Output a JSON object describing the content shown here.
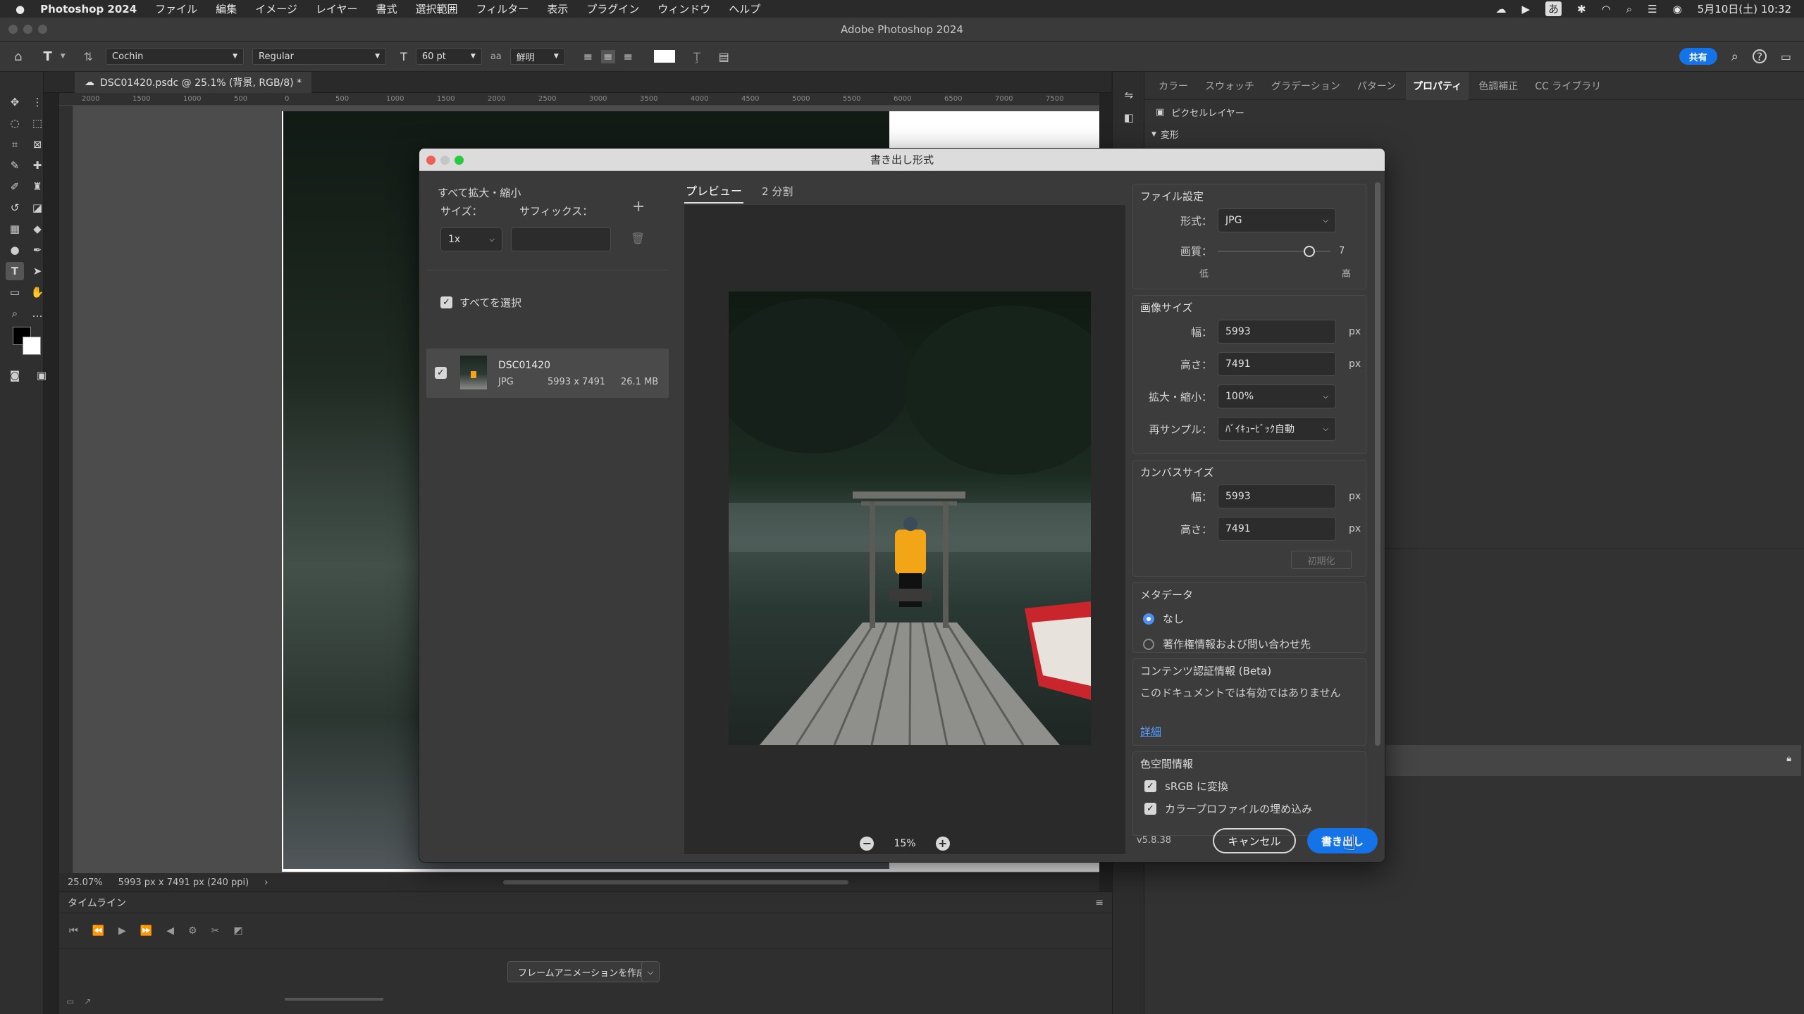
{
  "menubar": {
    "app_name": "Photoshop 2024",
    "items": [
      "ファイル",
      "編集",
      "イメージ",
      "レイヤー",
      "書式",
      "選択範囲",
      "フィルター",
      "表示",
      "プラグイン",
      "ウィンドウ",
      "ヘルプ"
    ],
    "ime": "あ",
    "datetime": "5月10日(土) 10:32"
  },
  "window": {
    "title": "Adobe Photoshop 2024"
  },
  "options": {
    "font_family": "Cochin",
    "font_style": "Regular",
    "font_size": "60 pt",
    "antialias_icon_label": "aa",
    "antialias": "鮮明",
    "share_label": "共有"
  },
  "document": {
    "tab_title": "DSC01420.psdc @ 25.1% (背景, RGB/8) *",
    "ruler_ticks": [
      "2000",
      "1500",
      "1000",
      "500",
      "0",
      "500",
      "1000",
      "1500",
      "2000",
      "2500",
      "3000",
      "3500",
      "4000",
      "4500",
      "5000",
      "5500",
      "6000",
      "6500",
      "7000",
      "7500"
    ],
    "zoom": "25.07%",
    "dims": "5993 px x 7491 px (240 ppi)"
  },
  "timeline": {
    "title": "タイムライン",
    "create_button": "フレームアニメーションを作成"
  },
  "right_panel": {
    "tabs": [
      "カラー",
      "スウォッチ",
      "グラデーション",
      "パターン",
      "プロパティ",
      "色調補正",
      "CC ライブラリ"
    ],
    "active_tab": "プロパティ",
    "layer_type": "ピクセルレイヤー",
    "section": "変形"
  },
  "dialog": {
    "title": "書き出し形式",
    "scale_section": "すべて拡大・縮小",
    "size_label": "サイズ：",
    "suffix_label": "サフィックス：",
    "scale_value": "1x",
    "select_all": "すべてを選択",
    "file": {
      "name": "DSC01420",
      "format": "JPG",
      "dims": "5993 x 7491",
      "size": "26.1 MB"
    },
    "preview_tabs": [
      "プレビュー",
      "2 分割"
    ],
    "zoom": "15%",
    "file_settings": {
      "title": "ファイル設定",
      "format_label": "形式：",
      "format_value": "JPG",
      "quality_label": "画質：",
      "quality_value": "7",
      "quality_low": "低",
      "quality_high": "高",
      "quality_level": 0.85
    },
    "image_size": {
      "title": "画像サイズ",
      "width_label": "幅：",
      "width": "5993",
      "height_label": "高さ：",
      "height": "7491",
      "unit": "px",
      "scale_label": "拡大・縮小：",
      "scale": "100%",
      "resample_label": "再サンプル：",
      "resample": "ﾊﾞｲｷｭｰﾋﾞｯｸ自動"
    },
    "canvas_size": {
      "title": "カンバスサイズ",
      "width_label": "幅：",
      "width": "5993",
      "height_label": "高さ：",
      "height": "7491",
      "unit": "px",
      "reset": "初期化"
    },
    "metadata": {
      "title": "メタデータ",
      "none": "なし",
      "copyright": "著作権情報および問い合わせ先"
    },
    "content_credentials": {
      "title": "コンテンツ認証情報 (Beta)",
      "message": "このドキュメントでは有効ではありません",
      "link": "詳細"
    },
    "color_space": {
      "title": "色空間情報",
      "srgb": "sRGB に変換",
      "embed": "カラープロファイルの埋め込み"
    },
    "version": "v5.8.38",
    "cancel": "キャンセル",
    "export": "書き出し"
  },
  "colors": {
    "accent": "#1473e6",
    "radio_on": "#4c8ff5",
    "jacket": "#f2a516",
    "boat": "#c8262c"
  }
}
